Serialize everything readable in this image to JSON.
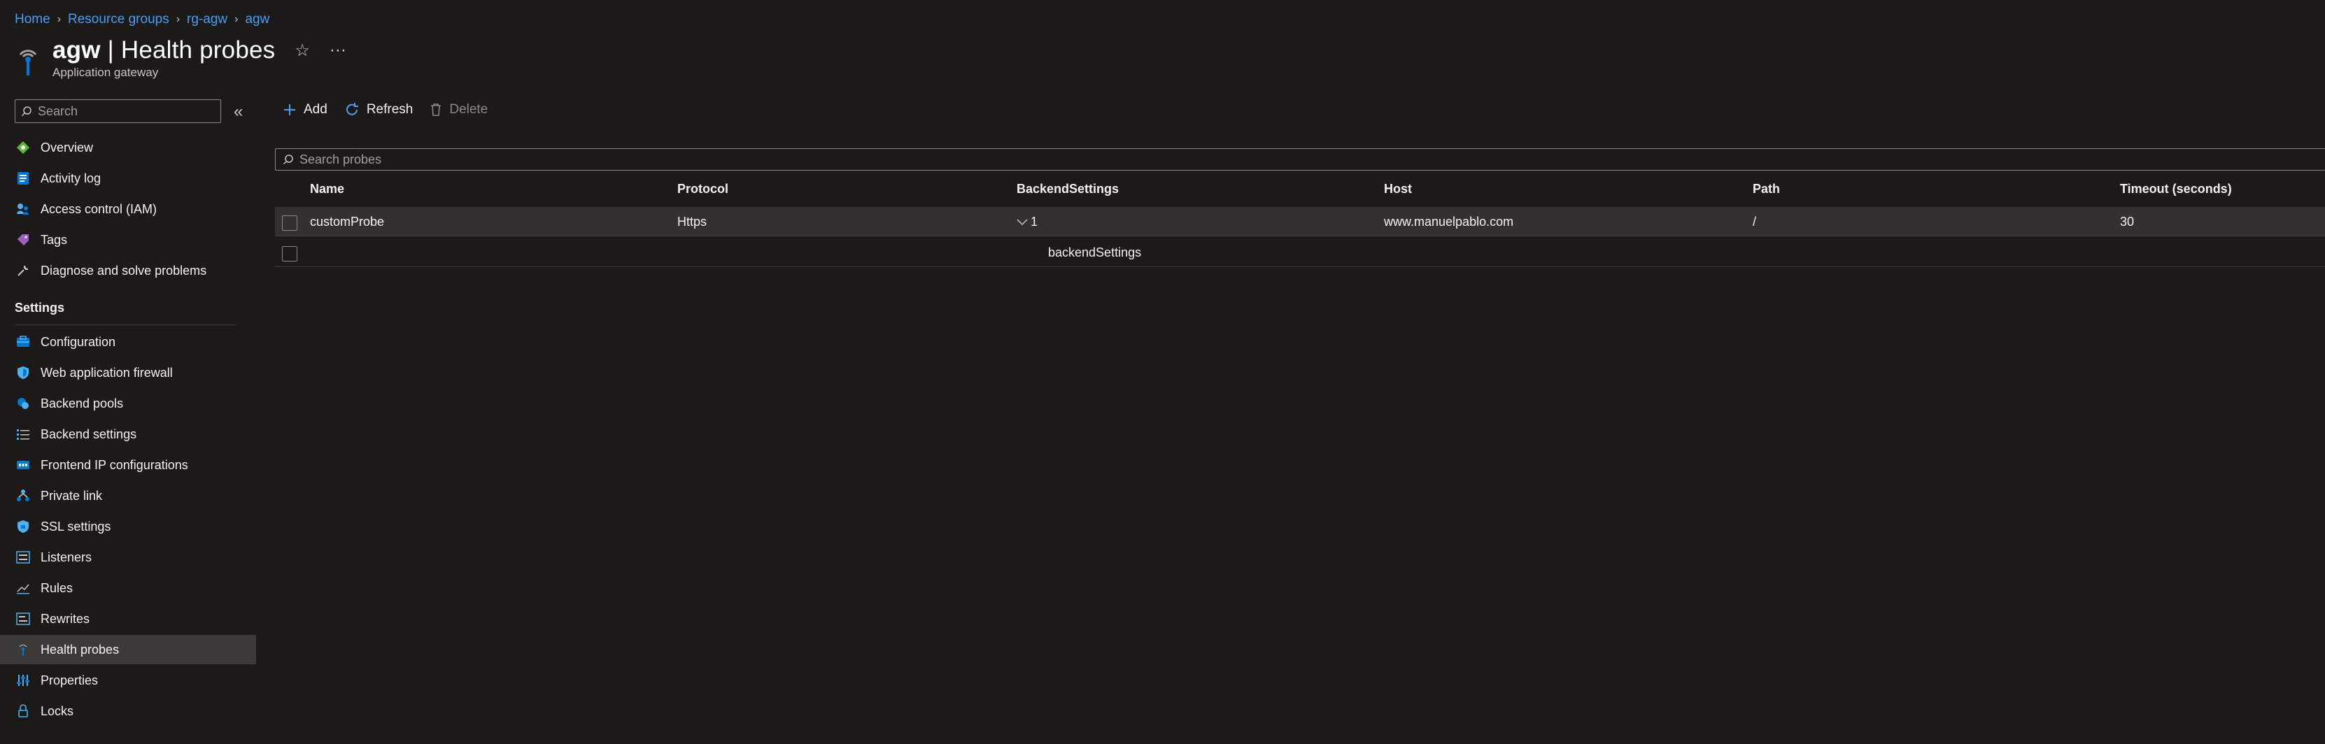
{
  "breadcrumb": {
    "home": "Home",
    "resource_groups": "Resource groups",
    "rg": "rg-agw",
    "resource": "agw"
  },
  "header": {
    "resource_name": "agw",
    "separator": "|",
    "page_name": "Health probes",
    "subtitle": "Application gateway",
    "favorite_icon": "star-icon",
    "more_icon": "more-icon"
  },
  "sidebar": {
    "search_placeholder": "Search",
    "top_items": [
      {
        "label": "Overview",
        "icon": "overview-icon"
      },
      {
        "label": "Activity log",
        "icon": "activity-log-icon"
      },
      {
        "label": "Access control (IAM)",
        "icon": "iam-icon"
      },
      {
        "label": "Tags",
        "icon": "tag-icon"
      },
      {
        "label": "Diagnose and solve problems",
        "icon": "wrench-icon"
      }
    ],
    "settings_header": "Settings",
    "settings_items": [
      {
        "label": "Configuration",
        "icon": "configuration-icon"
      },
      {
        "label": "Web application firewall",
        "icon": "shield-icon"
      },
      {
        "label": "Backend pools",
        "icon": "backend-pools-icon"
      },
      {
        "label": "Backend settings",
        "icon": "backend-settings-icon"
      },
      {
        "label": "Frontend IP configurations",
        "icon": "frontend-ip-icon"
      },
      {
        "label": "Private link",
        "icon": "private-link-icon"
      },
      {
        "label": "SSL settings",
        "icon": "ssl-shield-icon"
      },
      {
        "label": "Listeners",
        "icon": "listeners-icon"
      },
      {
        "label": "Rules",
        "icon": "rules-icon"
      },
      {
        "label": "Rewrites",
        "icon": "rewrites-icon"
      },
      {
        "label": "Health probes",
        "icon": "health-probe-icon",
        "active": true
      },
      {
        "label": "Properties",
        "icon": "properties-icon"
      },
      {
        "label": "Locks",
        "icon": "lock-icon"
      }
    ]
  },
  "toolbar": {
    "add_label": "Add",
    "refresh_label": "Refresh",
    "delete_label": "Delete"
  },
  "probe_search": {
    "placeholder": "Search probes"
  },
  "table": {
    "headers": {
      "name": "Name",
      "protocol": "Protocol",
      "backend_settings": "BackendSettings",
      "host": "Host",
      "path": "Path",
      "timeout": "Timeout (seconds)"
    },
    "rows": [
      {
        "name": "customProbe",
        "protocol": "Https",
        "backend_settings": "1",
        "host": "www.manuelpablo.com",
        "path": "/",
        "timeout": "30"
      }
    ],
    "sub_row": {
      "backend_settings": "backendSettings"
    }
  },
  "colors": {
    "accent": "#479ef5",
    "background": "#1b1a19",
    "active_nav": "#3b3a39"
  }
}
